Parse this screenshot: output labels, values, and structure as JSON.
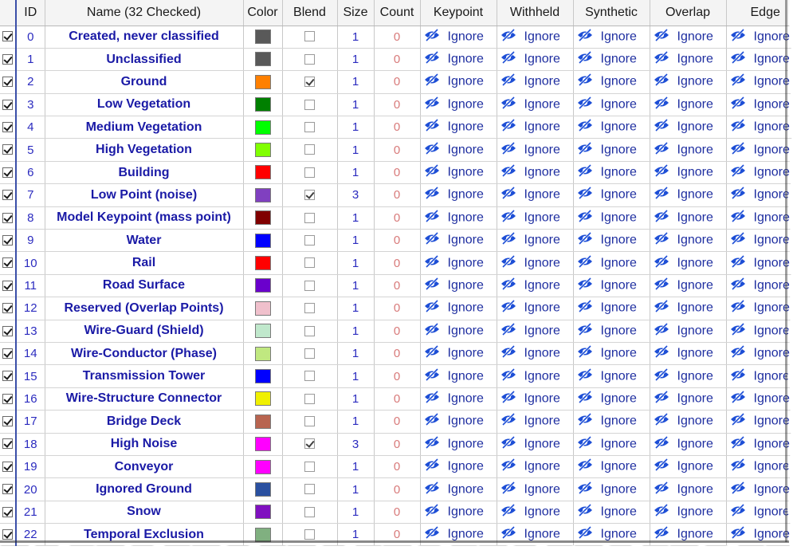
{
  "columns": {
    "id": "ID",
    "name": "Name (32 Checked)",
    "color": "Color",
    "blend": "Blend",
    "size": "Size",
    "count": "Count",
    "keypoint": "Keypoint",
    "withheld": "Withheld",
    "synthetic": "Synthetic",
    "overlap": "Overlap",
    "edge": "Edge"
  },
  "flag_value": "Ignore",
  "flag_icon": "hidden-eye-icon",
  "accent_color": "#1e4fd6",
  "rows": [
    {
      "checked": true,
      "id": "0",
      "name": "Created, never classified",
      "color": "#595959",
      "blend": false,
      "size": "1",
      "count": "0"
    },
    {
      "checked": true,
      "id": "1",
      "name": "Unclassified",
      "color": "#595959",
      "blend": false,
      "size": "1",
      "count": "0"
    },
    {
      "checked": true,
      "id": "2",
      "name": "Ground",
      "color": "#ff8000",
      "blend": true,
      "size": "1",
      "count": "0"
    },
    {
      "checked": true,
      "id": "3",
      "name": "Low Vegetation",
      "color": "#008000",
      "blend": false,
      "size": "1",
      "count": "0"
    },
    {
      "checked": true,
      "id": "4",
      "name": "Medium Vegetation",
      "color": "#00ff00",
      "blend": false,
      "size": "1",
      "count": "0"
    },
    {
      "checked": true,
      "id": "5",
      "name": "High Vegetation",
      "color": "#80ff00",
      "blend": false,
      "size": "1",
      "count": "0"
    },
    {
      "checked": true,
      "id": "6",
      "name": "Building",
      "color": "#ff0000",
      "blend": false,
      "size": "1",
      "count": "0"
    },
    {
      "checked": true,
      "id": "7",
      "name": "Low Point (noise)",
      "color": "#8040c0",
      "blend": true,
      "size": "3",
      "count": "0"
    },
    {
      "checked": true,
      "id": "8",
      "name": "Model Keypoint (mass point)",
      "color": "#800000",
      "blend": false,
      "size": "1",
      "count": "0"
    },
    {
      "checked": true,
      "id": "9",
      "name": "Water",
      "color": "#0000ff",
      "blend": false,
      "size": "1",
      "count": "0"
    },
    {
      "checked": true,
      "id": "10",
      "name": "Rail",
      "color": "#ff0000",
      "blend": false,
      "size": "1",
      "count": "0"
    },
    {
      "checked": true,
      "id": "11",
      "name": "Road Surface",
      "color": "#6a00cc",
      "blend": false,
      "size": "1",
      "count": "0"
    },
    {
      "checked": true,
      "id": "12",
      "name": "Reserved (Overlap Points)",
      "color": "#f0c0cc",
      "blend": false,
      "size": "1",
      "count": "0"
    },
    {
      "checked": true,
      "id": "13",
      "name": "Wire-Guard (Shield)",
      "color": "#c0e8cc",
      "blend": false,
      "size": "1",
      "count": "0"
    },
    {
      "checked": true,
      "id": "14",
      "name": "Wire-Conductor (Phase)",
      "color": "#c0e880",
      "blend": false,
      "size": "1",
      "count": "0"
    },
    {
      "checked": true,
      "id": "15",
      "name": "Transmission Tower",
      "color": "#0000ff",
      "blend": false,
      "size": "1",
      "count": "0"
    },
    {
      "checked": true,
      "id": "16",
      "name": "Wire-Structure Connector",
      "color": "#f0f000",
      "blend": false,
      "size": "1",
      "count": "0"
    },
    {
      "checked": true,
      "id": "17",
      "name": "Bridge Deck",
      "color": "#b86450",
      "blend": false,
      "size": "1",
      "count": "0"
    },
    {
      "checked": true,
      "id": "18",
      "name": "High Noise",
      "color": "#ff00ff",
      "blend": true,
      "size": "3",
      "count": "0"
    },
    {
      "checked": true,
      "id": "19",
      "name": "Conveyor",
      "color": "#ff00ff",
      "blend": false,
      "size": "1",
      "count": "0"
    },
    {
      "checked": true,
      "id": "20",
      "name": "Ignored Ground",
      "color": "#2a50a0",
      "blend": false,
      "size": "1",
      "count": "0"
    },
    {
      "checked": true,
      "id": "21",
      "name": "Snow",
      "color": "#8010c0",
      "blend": false,
      "size": "1",
      "count": "0"
    },
    {
      "checked": true,
      "id": "22",
      "name": "Temporal Exclusion",
      "color": "#80b080",
      "blend": false,
      "size": "1",
      "count": "0"
    }
  ]
}
